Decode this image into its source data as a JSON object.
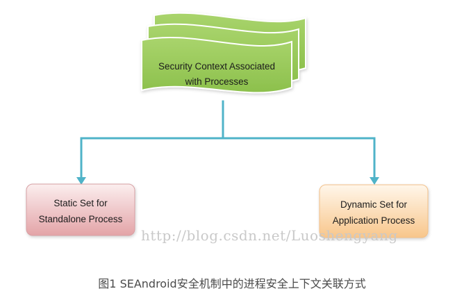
{
  "diagram": {
    "top_node": {
      "line1": "Security Context Associated",
      "line2": "with Processes"
    },
    "left_node": {
      "line1": "Static Set for",
      "line2": "Standalone Process"
    },
    "right_node": {
      "line1": "Dynamic Set for",
      "line2": "Application Process"
    },
    "watermark": "http://blog.csdn.net/Luoshengyang",
    "colors": {
      "top_fill": "#9ccc5c",
      "top_stroke": "#ffffff",
      "connector": "#4fb3c8",
      "left_fill_light": "#fbeaea",
      "left_fill_dark": "#e6a8ab",
      "left_stroke": "#d7a0a4",
      "right_fill_light": "#fff3e2",
      "right_fill_dark": "#f9c990",
      "right_stroke": "#f2c089"
    }
  },
  "caption": "图1 SEAndroid安全机制中的进程安全上下文关联方式"
}
